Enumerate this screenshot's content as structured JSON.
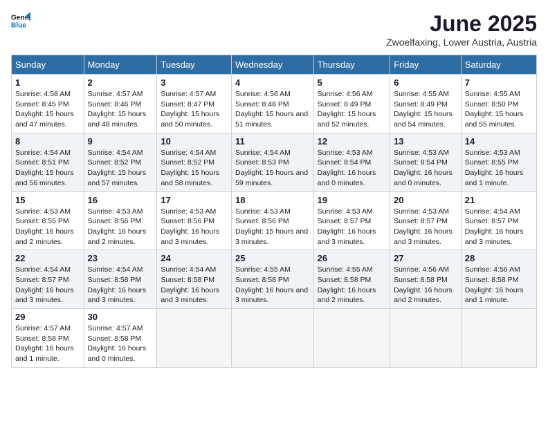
{
  "logo": {
    "line1": "General",
    "line2": "Blue"
  },
  "title": "June 2025",
  "location": "Zwoelfaxing, Lower Austria, Austria",
  "days_of_week": [
    "Sunday",
    "Monday",
    "Tuesday",
    "Wednesday",
    "Thursday",
    "Friday",
    "Saturday"
  ],
  "weeks": [
    [
      {
        "day": "1",
        "sunrise": "4:58 AM",
        "sunset": "8:45 PM",
        "daylight": "15 hours and 47 minutes."
      },
      {
        "day": "2",
        "sunrise": "4:57 AM",
        "sunset": "8:46 PM",
        "daylight": "15 hours and 48 minutes."
      },
      {
        "day": "3",
        "sunrise": "4:57 AM",
        "sunset": "8:47 PM",
        "daylight": "15 hours and 50 minutes."
      },
      {
        "day": "4",
        "sunrise": "4:56 AM",
        "sunset": "8:48 PM",
        "daylight": "15 hours and 51 minutes."
      },
      {
        "day": "5",
        "sunrise": "4:56 AM",
        "sunset": "8:49 PM",
        "daylight": "15 hours and 52 minutes."
      },
      {
        "day": "6",
        "sunrise": "4:55 AM",
        "sunset": "8:49 PM",
        "daylight": "15 hours and 54 minutes."
      },
      {
        "day": "7",
        "sunrise": "4:55 AM",
        "sunset": "8:50 PM",
        "daylight": "15 hours and 55 minutes."
      }
    ],
    [
      {
        "day": "8",
        "sunrise": "4:54 AM",
        "sunset": "8:51 PM",
        "daylight": "15 hours and 56 minutes."
      },
      {
        "day": "9",
        "sunrise": "4:54 AM",
        "sunset": "8:52 PM",
        "daylight": "15 hours and 57 minutes."
      },
      {
        "day": "10",
        "sunrise": "4:54 AM",
        "sunset": "8:52 PM",
        "daylight": "15 hours and 58 minutes."
      },
      {
        "day": "11",
        "sunrise": "4:54 AM",
        "sunset": "8:53 PM",
        "daylight": "15 hours and 59 minutes."
      },
      {
        "day": "12",
        "sunrise": "4:53 AM",
        "sunset": "8:54 PM",
        "daylight": "16 hours and 0 minutes."
      },
      {
        "day": "13",
        "sunrise": "4:53 AM",
        "sunset": "8:54 PM",
        "daylight": "16 hours and 0 minutes."
      },
      {
        "day": "14",
        "sunrise": "4:53 AM",
        "sunset": "8:55 PM",
        "daylight": "16 hours and 1 minute."
      }
    ],
    [
      {
        "day": "15",
        "sunrise": "4:53 AM",
        "sunset": "8:55 PM",
        "daylight": "16 hours and 2 minutes."
      },
      {
        "day": "16",
        "sunrise": "4:53 AM",
        "sunset": "8:56 PM",
        "daylight": "16 hours and 2 minutes."
      },
      {
        "day": "17",
        "sunrise": "4:53 AM",
        "sunset": "8:56 PM",
        "daylight": "16 hours and 3 minutes."
      },
      {
        "day": "18",
        "sunrise": "4:53 AM",
        "sunset": "8:56 PM",
        "daylight": "15 hours and 3 minutes."
      },
      {
        "day": "19",
        "sunrise": "4:53 AM",
        "sunset": "8:57 PM",
        "daylight": "16 hours and 3 minutes."
      },
      {
        "day": "20",
        "sunrise": "4:53 AM",
        "sunset": "8:57 PM",
        "daylight": "16 hours and 3 minutes."
      },
      {
        "day": "21",
        "sunrise": "4:54 AM",
        "sunset": "8:57 PM",
        "daylight": "16 hours and 3 minutes."
      }
    ],
    [
      {
        "day": "22",
        "sunrise": "4:54 AM",
        "sunset": "8:57 PM",
        "daylight": "16 hours and 3 minutes."
      },
      {
        "day": "23",
        "sunrise": "4:54 AM",
        "sunset": "8:58 PM",
        "daylight": "16 hours and 3 minutes."
      },
      {
        "day": "24",
        "sunrise": "4:54 AM",
        "sunset": "8:58 PM",
        "daylight": "16 hours and 3 minutes."
      },
      {
        "day": "25",
        "sunrise": "4:55 AM",
        "sunset": "8:58 PM",
        "daylight": "16 hours and 3 minutes."
      },
      {
        "day": "26",
        "sunrise": "4:55 AM",
        "sunset": "8:58 PM",
        "daylight": "16 hours and 2 minutes."
      },
      {
        "day": "27",
        "sunrise": "4:56 AM",
        "sunset": "8:58 PM",
        "daylight": "16 hours and 2 minutes."
      },
      {
        "day": "28",
        "sunrise": "4:56 AM",
        "sunset": "8:58 PM",
        "daylight": "16 hours and 1 minute."
      }
    ],
    [
      {
        "day": "29",
        "sunrise": "4:57 AM",
        "sunset": "8:58 PM",
        "daylight": "16 hours and 1 minute."
      },
      {
        "day": "30",
        "sunrise": "4:57 AM",
        "sunset": "8:58 PM",
        "daylight": "16 hours and 0 minutes."
      },
      null,
      null,
      null,
      null,
      null
    ]
  ]
}
